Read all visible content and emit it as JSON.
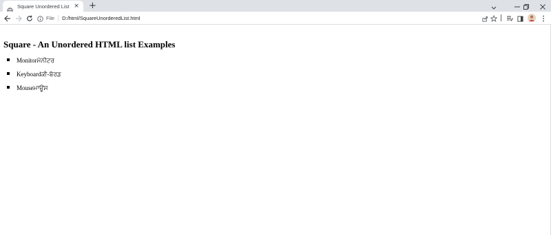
{
  "browser": {
    "tab": {
      "title": "Square Unordered List",
      "favicon": "globe-icon",
      "close": "×"
    },
    "new_tab_label": "+",
    "window_controls": [
      "chevron-down-icon",
      "minimize-icon",
      "restore-icon",
      "close-icon"
    ],
    "toolbar": {
      "back": "back-arrow-icon",
      "forward": "forward-arrow-icon",
      "reload": "reload-icon",
      "site_info": "info-icon",
      "scheme_label": "File",
      "address": "D:/html/SquareUnorderedList.html",
      "actions": [
        "share-icon",
        "bookmark-star-icon",
        "reading-list-icon",
        "side-panel-icon",
        "profile-avatar",
        "menu-dots-icon"
      ]
    }
  },
  "page": {
    "heading": "Square - An Unordered HTML list Examples",
    "items": [
      {
        "label": "Monitor",
        "translation": "ਮੋਨੀਟਰ"
      },
      {
        "label": "Keyboard",
        "translation": "ਕੀ-ਬੋਰਡ"
      },
      {
        "label": "Mouse",
        "translation": "ਮਾਊਸ"
      }
    ]
  },
  "colors": {
    "tabstrip_bg": "#dee1e6",
    "toolbar_bg": "#ffffff",
    "page_bg": "#ffffff",
    "text": "#000000"
  }
}
